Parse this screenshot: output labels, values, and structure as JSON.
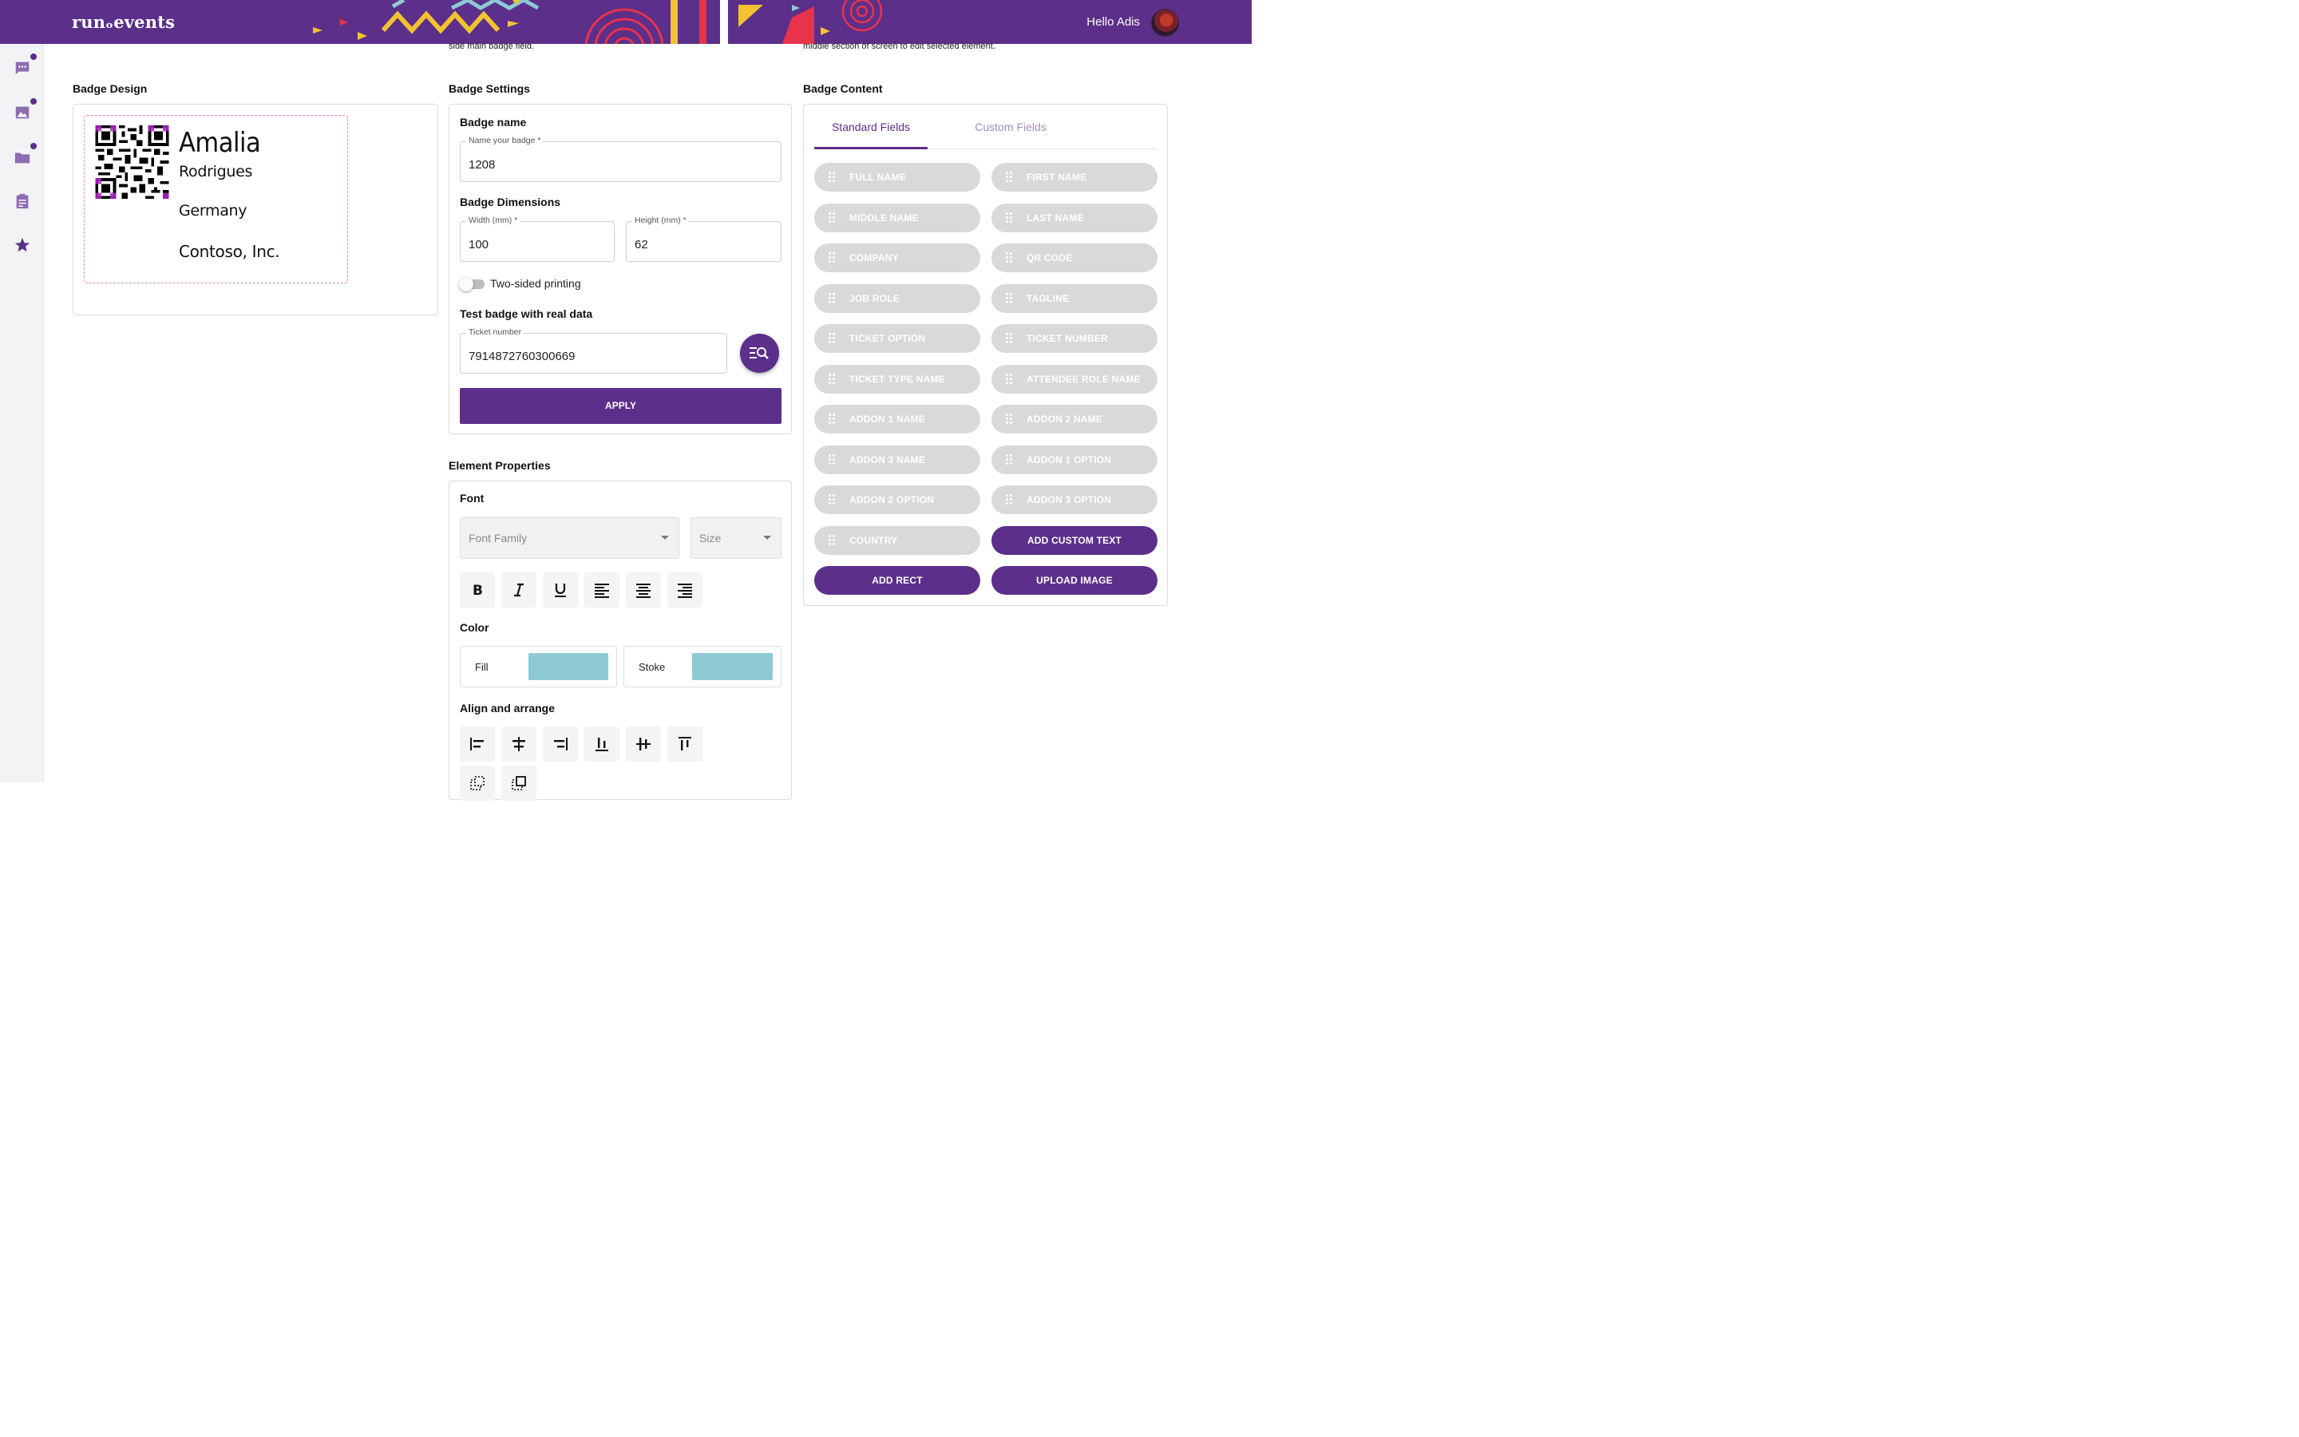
{
  "header": {
    "logo_text": "runₒevents",
    "greeting": "Hello Adis",
    "brand_color": "#5b2f8a"
  },
  "sidebar": {
    "items": [
      {
        "icon": "chat-icon",
        "has_badge": true
      },
      {
        "icon": "image-icon",
        "has_badge": true
      },
      {
        "icon": "folder-icon",
        "has_badge": true
      },
      {
        "icon": "clipboard-icon",
        "has_badge": false
      },
      {
        "icon": "star-icon",
        "has_badge": false
      }
    ]
  },
  "cut_texts": {
    "settings_hint": "side main badge field.",
    "content_hint": "middle section of screen to edit selected element."
  },
  "badge_design": {
    "title": "Badge Design",
    "preview": {
      "first_name": "Amalia",
      "last_name": "Rodrigues",
      "country": "Germany",
      "company": "Contoso, Inc."
    }
  },
  "badge_settings": {
    "title": "Badge Settings",
    "name_section": "Badge name",
    "name_label": "Name your badge *",
    "name_value": "1208",
    "dimensions_section": "Badge Dimensions",
    "width_label": "Width (mm) *",
    "width_value": "100",
    "height_label": "Height (mm) *",
    "height_value": "62",
    "two_sided_label": "Two-sided printing",
    "two_sided_on": false,
    "test_section": "Test badge with real data",
    "ticket_label": "Ticket number",
    "ticket_value": "7914872760300669",
    "apply_label": "APPLY"
  },
  "element_properties": {
    "title": "Element Properties",
    "font_section": "Font",
    "font_family_placeholder": "Font Family",
    "size_placeholder": "Size",
    "format_tools": [
      "bold-icon",
      "italic-icon",
      "underline-icon",
      "align-left-icon",
      "align-center-icon",
      "align-right-icon"
    ],
    "color_section": "Color",
    "fill_label": "Fill",
    "stroke_label": "Stoke",
    "fill_color": "#8ecad4",
    "stroke_color": "#8ecad4",
    "align_section": "Align and arrange",
    "align_tools": [
      "align-left-edge-icon",
      "align-center-horizontal-icon",
      "align-right-edge-icon",
      "align-bottom-icon",
      "align-center-vertical-icon",
      "align-top-icon",
      "send-backward-icon",
      "bring-forward-icon"
    ]
  },
  "badge_content": {
    "title": "Badge Content",
    "tabs": [
      {
        "label": "Standard Fields",
        "active": true
      },
      {
        "label": "Custom Fields",
        "active": false
      }
    ],
    "fields": [
      "FULL NAME",
      "FIRST NAME",
      "MIDDLE NAME",
      "LAST NAME",
      "COMPANY",
      "QR CODE",
      "JOB ROLE",
      "TAGLINE",
      "TICKET OPTION",
      "TICKET NUMBER",
      "TICKET TYPE NAME",
      "ATTENDEE ROLE NAME",
      "ADDON 1 NAME",
      "ADDON 2 NAME",
      "ADDON 3 NAME",
      "ADDON 1 OPTION",
      "ADDON 2 OPTION",
      "ADDON 3 OPTION",
      "COUNTRY"
    ],
    "add_custom_text": "ADD CUSTOM TEXT",
    "add_rect": "ADD RECT",
    "upload_image": "UPLOAD IMAGE"
  }
}
